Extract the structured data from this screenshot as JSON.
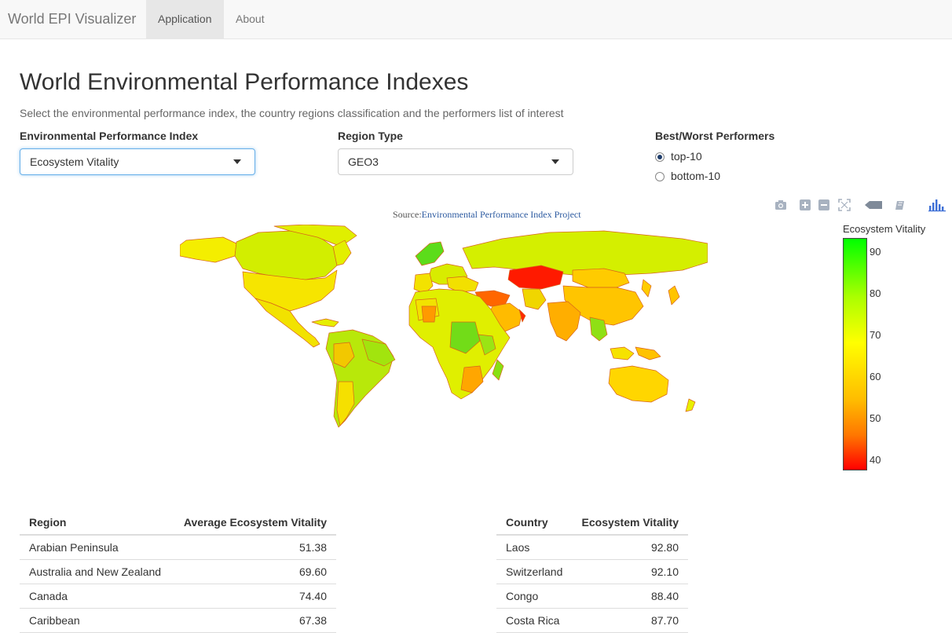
{
  "navbar": {
    "brand": "World EPI Visualizer",
    "tabs": [
      {
        "label": "Application",
        "active": true
      },
      {
        "label": "About",
        "active": false
      }
    ]
  },
  "page": {
    "title": "World Environmental Performance Indexes",
    "subtitle": "Select the environmental performance index, the country regions classification and the performers list of interest"
  },
  "controls": {
    "index_label": "Environmental Performance Index",
    "index_value": "Ecosystem Vitality",
    "region_label": "Region Type",
    "region_value": "GEO3",
    "performers_label": "Best/Worst Performers",
    "performers_options": [
      {
        "label": "top-10",
        "checked": true
      },
      {
        "label": "bottom-10",
        "checked": false
      }
    ]
  },
  "map": {
    "source_prefix": "Source:",
    "source_link": "Environmental Performance Index Project",
    "modebar_icons": [
      "camera-icon",
      "zoom-in-icon",
      "zoom-out-icon",
      "autoscale-icon",
      "hover-closest-icon",
      "hover-compare-icon",
      "plotly-logo-icon"
    ],
    "colorscale": {
      "high": "#00ff00",
      "mid": "#ffff00",
      "low": "#ff0000"
    }
  },
  "colorbar": {
    "title": "Ecosystem Vitality",
    "ticks": [
      "90",
      "80",
      "70",
      "60",
      "50",
      "40"
    ]
  },
  "region_table": {
    "headers": [
      "Region",
      "Average Ecosystem Vitality"
    ],
    "rows": [
      [
        "Arabian Peninsula",
        "51.38"
      ],
      [
        "Australia and New Zealand",
        "69.60"
      ],
      [
        "Canada",
        "74.40"
      ],
      [
        "Caribbean",
        "67.38"
      ]
    ]
  },
  "country_table": {
    "headers": [
      "Country",
      "Ecosystem Vitality"
    ],
    "rows": [
      [
        "Laos",
        "92.80"
      ],
      [
        "Switzerland",
        "92.10"
      ],
      [
        "Congo",
        "88.40"
      ],
      [
        "Costa Rica",
        "87.70"
      ]
    ]
  }
}
